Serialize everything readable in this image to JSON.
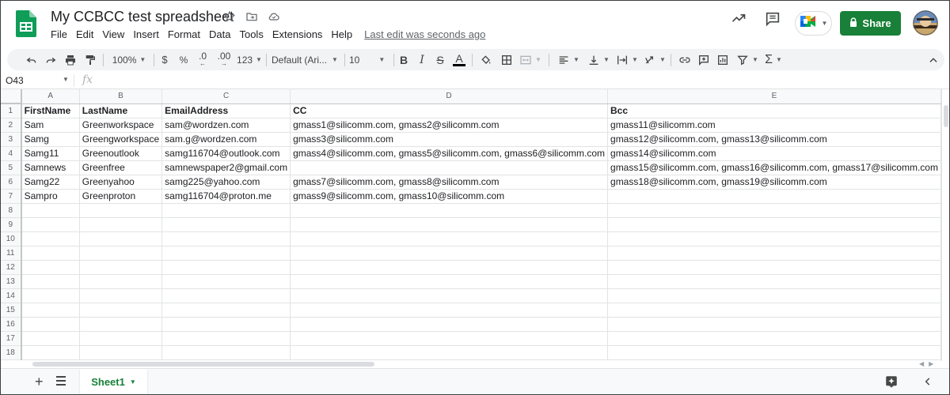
{
  "app": {
    "title": "My CCBCC test spreadsheet",
    "menus": [
      "File",
      "Edit",
      "View",
      "Insert",
      "Format",
      "Data",
      "Tools",
      "Extensions",
      "Help"
    ],
    "last_edit": "Last edit was seconds ago",
    "share_label": "Share",
    "brand_color": "#188038"
  },
  "toolbar": {
    "zoom": "100%",
    "currency": "$",
    "percent": "%",
    "dec_decrease": ".0",
    "dec_increase": ".00",
    "more_formats": "123",
    "font": "Default (Ari...",
    "font_size": "10",
    "bold": "B",
    "italic": "I",
    "strike": "S",
    "text_color": "A"
  },
  "formula_bar": {
    "name_box": "O43",
    "fx": "fx"
  },
  "columns": [
    "A",
    "B",
    "C",
    "D",
    "E"
  ],
  "rows": [
    [
      "FirstName",
      "LastName",
      "EmailAddress",
      "CC",
      "Bcc"
    ],
    [
      "Sam",
      "Greenworkspace",
      "sam@wordzen.com",
      "gmass1@silicomm.com, gmass2@silicomm.com",
      "gmass11@silicomm.com"
    ],
    [
      "Samg",
      "Greengworkspace",
      "sam.g@wordzen.com",
      "gmass3@silicomm.com",
      "gmass12@silicomm.com, gmass13@silicomm.com"
    ],
    [
      "Samg11",
      "Greenoutlook",
      "samg116704@outlook.com",
      "gmass4@silicomm.com, gmass5@silicomm.com, gmass6@silicomm.com",
      "gmass14@silicomm.com"
    ],
    [
      "Samnews",
      "Greenfree",
      "samnewspaper2@gmail.com",
      "",
      "gmass15@silicomm.com, gmass16@silicomm.com, gmass17@silicomm.com"
    ],
    [
      "Samg22",
      "Greenyahoo",
      "samg225@yahoo.com",
      "gmass7@silicomm.com, gmass8@silicomm.com",
      "gmass18@silicomm.com, gmass19@silicomm.com"
    ],
    [
      "Sampro",
      "Greenproton",
      "samg116704@proton.me",
      "gmass9@silicomm.com, gmass10@silicomm.com",
      ""
    ],
    [
      "",
      "",
      "",
      "",
      ""
    ],
    [
      "",
      "",
      "",
      "",
      ""
    ],
    [
      "",
      "",
      "",
      "",
      ""
    ],
    [
      "",
      "",
      "",
      "",
      ""
    ],
    [
      "",
      "",
      "",
      "",
      ""
    ],
    [
      "",
      "",
      "",
      "",
      ""
    ],
    [
      "",
      "",
      "",
      "",
      ""
    ],
    [
      "",
      "",
      "",
      "",
      ""
    ],
    [
      "",
      "",
      "",
      "",
      ""
    ],
    [
      "",
      "",
      "",
      "",
      ""
    ],
    [
      "",
      "",
      "",
      "",
      ""
    ]
  ],
  "row_numbers": [
    "1",
    "2",
    "3",
    "4",
    "5",
    "6",
    "7",
    "8",
    "9",
    "10",
    "11",
    "12",
    "13",
    "14",
    "15",
    "16",
    "17",
    "18"
  ],
  "sheets": [
    {
      "name": "Sheet1",
      "active": true
    }
  ]
}
